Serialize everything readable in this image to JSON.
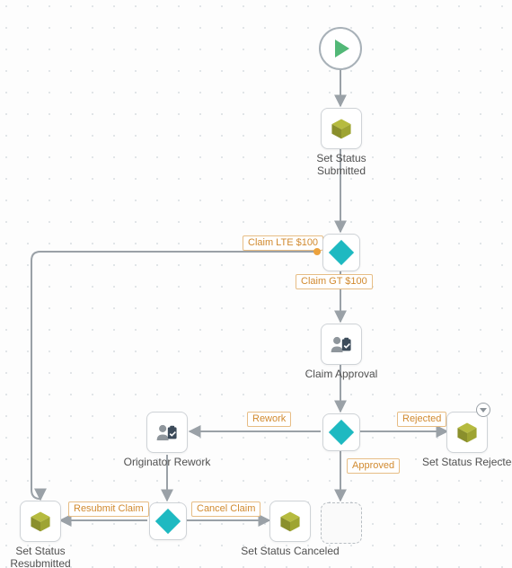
{
  "nodes": {
    "start": {
      "label": ""
    },
    "set_status_submitted": {
      "label": "Set Status\nSubmitted"
    },
    "gateway_amount": {
      "label": ""
    },
    "claim_approval": {
      "label": "Claim Approval"
    },
    "gateway_approval": {
      "label": ""
    },
    "originator_rework": {
      "label": "Originator Rework"
    },
    "gateway_rework": {
      "label": ""
    },
    "set_status_resubmitted": {
      "label": "Set Status\nResubmitted"
    },
    "set_status_canceled": {
      "label": "Set Status Canceled"
    },
    "set_status_rejected": {
      "label": "Set Status Rejected"
    },
    "placeholder": {
      "label": ""
    }
  },
  "edges": {
    "claim_lte_100": {
      "label": "Claim LTE $100"
    },
    "claim_gt_100": {
      "label": "Claim GT $100"
    },
    "rework": {
      "label": "Rework"
    },
    "rejected": {
      "label": "Rejected"
    },
    "approved": {
      "label": "Approved"
    },
    "resubmit_claim": {
      "label": "Resubmit Claim"
    },
    "cancel_claim": {
      "label": "Cancel Claim"
    }
  }
}
